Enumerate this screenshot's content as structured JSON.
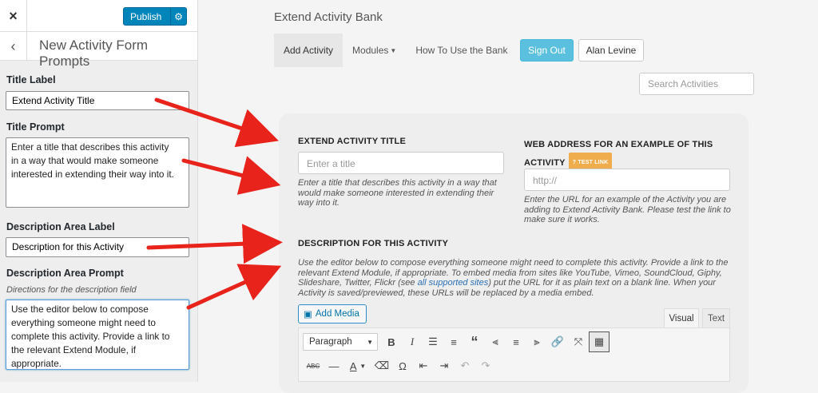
{
  "customizer": {
    "close_icon": "×",
    "publish_label": "Publish",
    "back_icon": "‹",
    "section_title": "New Activity Form Prompts",
    "title_label_heading": "Title Label",
    "title_label_value": "Extend Activity Title",
    "title_prompt_heading": "Title Prompt",
    "title_prompt_value": "Enter a title that describes this activity\nin a way that would make someone\ninterested in extending their way into it.",
    "desc_label_heading": "Description Area Label",
    "desc_label_value": "Description for this Activity",
    "desc_prompt_heading": "Description Area Prompt",
    "desc_prompt_help": "Directions for the description field",
    "desc_prompt_value": "Use the editor below to compose\neverything someone might need to\ncomplete this activity. Provide a link to\nthe relevant Extend Module, if\nappropriate."
  },
  "site": {
    "title": "Extend Activity Bank",
    "nav": [
      "Add Activity",
      "Modules",
      "How To Use the Bank"
    ],
    "sign_out": "Sign Out",
    "user": "Alan Levine",
    "search_placeholder": "Search Activities"
  },
  "form": {
    "title_heading": "EXTEND ACTIVITY TITLE",
    "title_placeholder": "Enter a title",
    "title_help": "Enter a title that describes this activity in a way that would make someone interested in extending their way into it.",
    "web_heading": "WEB ADDRESS FOR AN EXAMPLE OF THIS ACTIVITY",
    "test_link": "TEST LINK",
    "web_placeholder": "http://",
    "web_help": "Enter the URL for an example of the Activity you are adding to Extend Activity Bank. Please test the link to make sure it works.",
    "desc_heading": "DESCRIPTION FOR THIS ACTIVITY",
    "desc_help_a": "Use the editor below to compose everything someone might need to complete this activity. Provide a link to the relevant Extend Module, if appropriate. To embed media from sites like YouTube, Vimeo, SoundCloud, Giphy, Slideshare, Twitter, Flickr (see ",
    "desc_help_link": "all supported sites",
    "desc_help_b": ") put the URL for it as plain text on a blank line. When your Activity is saved/previewed, these URLs will be replaced by a media embed.",
    "add_media": "Add Media",
    "tab_visual": "Visual",
    "tab_text": "Text",
    "format_select": "Paragraph"
  },
  "colors": {
    "publish": "#0085ba",
    "sign_out": "#5bc0de",
    "arrow": "#e8231b",
    "test_link": "#f0ad4e"
  }
}
